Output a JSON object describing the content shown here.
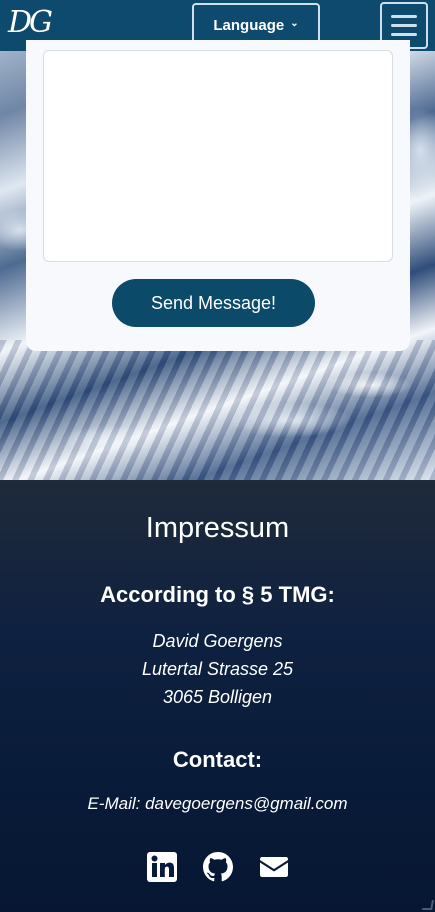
{
  "navbar": {
    "logo_text": "DG",
    "language_label": "Language"
  },
  "contact_form": {
    "send_label": "Send Message!"
  },
  "footer": {
    "title": "Impressum",
    "subtitle": "According to § 5 TMG:",
    "address": [
      "David Goergens",
      "Lutertal Strasse 25",
      "3065 Bolligen"
    ],
    "contact_heading": "Contact:",
    "email_line": "E-Mail: davegoergens@gmail.com",
    "social": [
      {
        "icon": "linkedin-icon"
      },
      {
        "icon": "github-icon"
      },
      {
        "icon": "mail-icon"
      }
    ]
  },
  "colors": {
    "navbar": "#0d4a6e",
    "button": "#0b4a68",
    "footer": "#081b38"
  }
}
